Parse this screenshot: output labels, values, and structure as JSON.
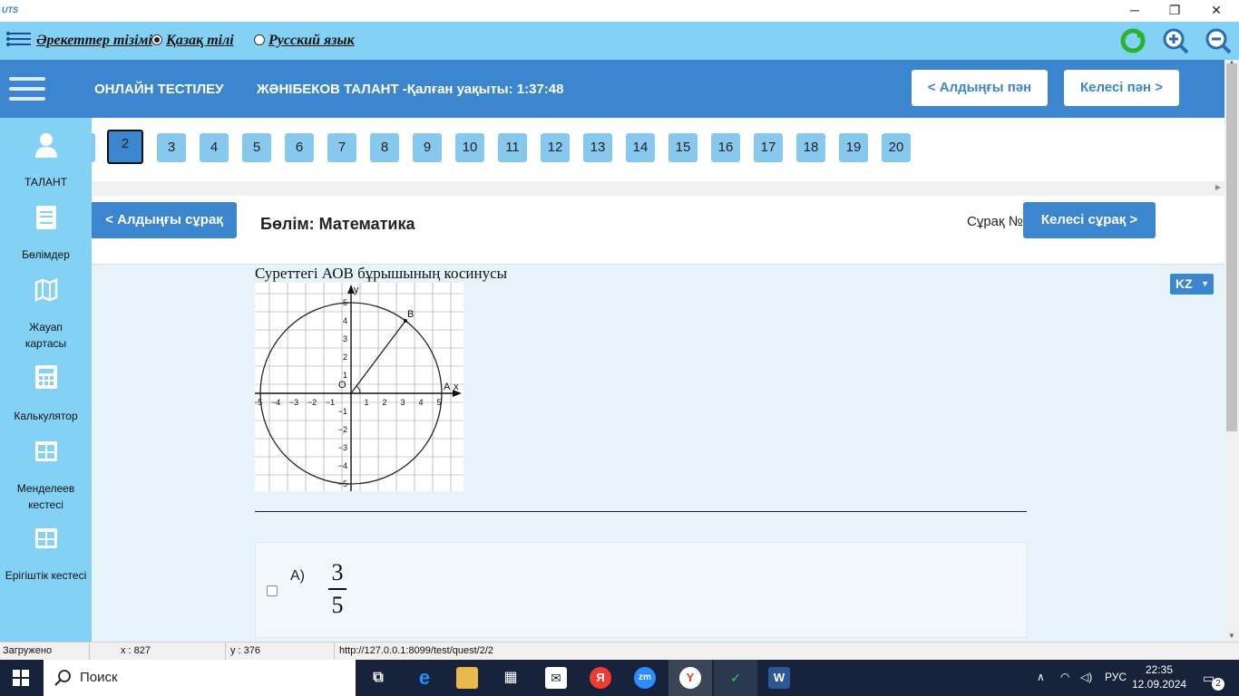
{
  "window": {
    "app_logo": "UTS",
    "minimize": "─",
    "restore": "❐",
    "close": "✕"
  },
  "toolbar": {
    "menu_label": "Әрекеттер тізімі",
    "lang_kz": "Қазақ тілі",
    "lang_ru": "Русский язык",
    "selected_lang": "kz"
  },
  "header": {
    "title": "ОНЛАЙН ТЕСТІЛЕУ",
    "user_timer": "ЖӘНІБЕКОВ ТАЛАНТ -Қалған уақыты: 1:37:48",
    "prev_subject": "< Алдыңғы пән",
    "next_subject": "Келесі пән >"
  },
  "sidebar": {
    "items": [
      {
        "label": "ТАЛАНТ",
        "icon": "user-icon"
      },
      {
        "label": "Бөлімдер",
        "icon": "book-icon"
      },
      {
        "label": "Жауап картасы",
        "icon": "map-icon"
      },
      {
        "label": "Калькулятор",
        "icon": "calculator-icon"
      },
      {
        "label": "Менделеев кестесі",
        "icon": "table-icon"
      },
      {
        "label": "Ерігіштік кестесі",
        "icon": "table-icon"
      }
    ]
  },
  "question_nav": {
    "current": "2",
    "numbers": [
      "3",
      "4",
      "5",
      "6",
      "7",
      "8",
      "9",
      "10",
      "11",
      "12",
      "13",
      "14",
      "15",
      "16",
      "17",
      "18",
      "19",
      "20"
    ]
  },
  "section": {
    "prev_question": "< Алдыңғы сұрақ",
    "title": "Бөлім: Математика",
    "question_number_label": "Сұрақ №",
    "next_question": "Келесі сұрақ >"
  },
  "question": {
    "text": "Суреттегі АОВ бұрышының косинусы",
    "language_select": "KZ"
  },
  "graph": {
    "x_ticks": [
      "−5",
      "−4",
      "−3",
      "−2",
      "−1",
      "1",
      "2",
      "3",
      "4",
      "5"
    ],
    "y_ticks": [
      "5",
      "4",
      "3",
      "2",
      "1",
      "−1",
      "−2",
      "−3",
      "−4",
      "−5"
    ],
    "x_axis_label": "x",
    "y_axis_label": "y",
    "origin_label": "O",
    "point_a_label": "A",
    "point_b_label": "B",
    "point_b": [
      3,
      4
    ],
    "point_a": [
      5,
      0
    ],
    "radius": 5
  },
  "answers": [
    {
      "letter": "A)",
      "numerator": "3",
      "denominator": "5"
    }
  ],
  "statusbar": {
    "status": "Загружено",
    "x_coord": "x : 827",
    "y_coord": "y : 376",
    "url": "http://127.0.0.1:8099/test/quest/2/2"
  },
  "taskbar": {
    "search_label": "Поиск",
    "lang": "РУС",
    "time": "22:35",
    "date": "12.09.2024",
    "notifications": "2"
  }
}
